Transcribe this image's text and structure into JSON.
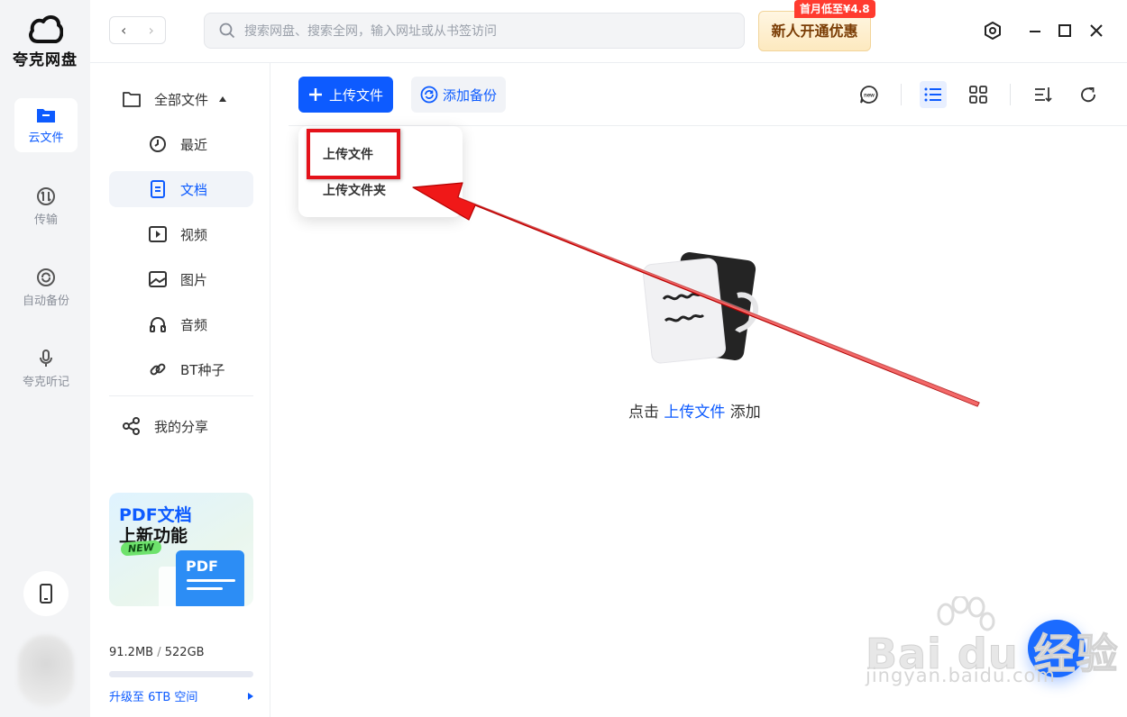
{
  "app": {
    "logo_text": "夸克网盘"
  },
  "rail": {
    "items": [
      {
        "label": "云文件"
      },
      {
        "label": "传输"
      },
      {
        "label": "自动备份"
      },
      {
        "label": "夸克听记"
      }
    ]
  },
  "nav": {
    "back": "‹",
    "forward": "›"
  },
  "search": {
    "placeholder": "搜索网盘、搜索全网，输入网址或从书签访问"
  },
  "promo": {
    "button": "新人开通优惠",
    "tag": "首月低至¥4.8"
  },
  "sidebar": {
    "all_files": "全部文件",
    "items": [
      {
        "label": "最近"
      },
      {
        "label": "文档"
      },
      {
        "label": "视频"
      },
      {
        "label": "图片"
      },
      {
        "label": "音频"
      },
      {
        "label": "BT种子"
      }
    ],
    "share": "我的分享",
    "banner": {
      "title": "PDF文档",
      "subtitle": "上新功能",
      "badge": "NEW",
      "card": "PDF"
    },
    "storage": {
      "used": "91.2MB",
      "sep": " / ",
      "total": "522GB",
      "fraction": 0.0002
    },
    "upgrade": "升级至 6TB 空间"
  },
  "toolbar": {
    "upload": "上传文件",
    "backup": "添加备份"
  },
  "dropdown": {
    "items": [
      "上传文件",
      "上传文件夹"
    ]
  },
  "empty": {
    "prefix": "点击 ",
    "link": "上传文件",
    "suffix": " 添加"
  },
  "watermark": {
    "text": "Bai du 经验",
    "sub": "jingyan.baidu.com"
  },
  "colors": {
    "accent": "#0d5bff",
    "highlight": "#e4121a",
    "promo_tag": "#ff3b2f"
  }
}
